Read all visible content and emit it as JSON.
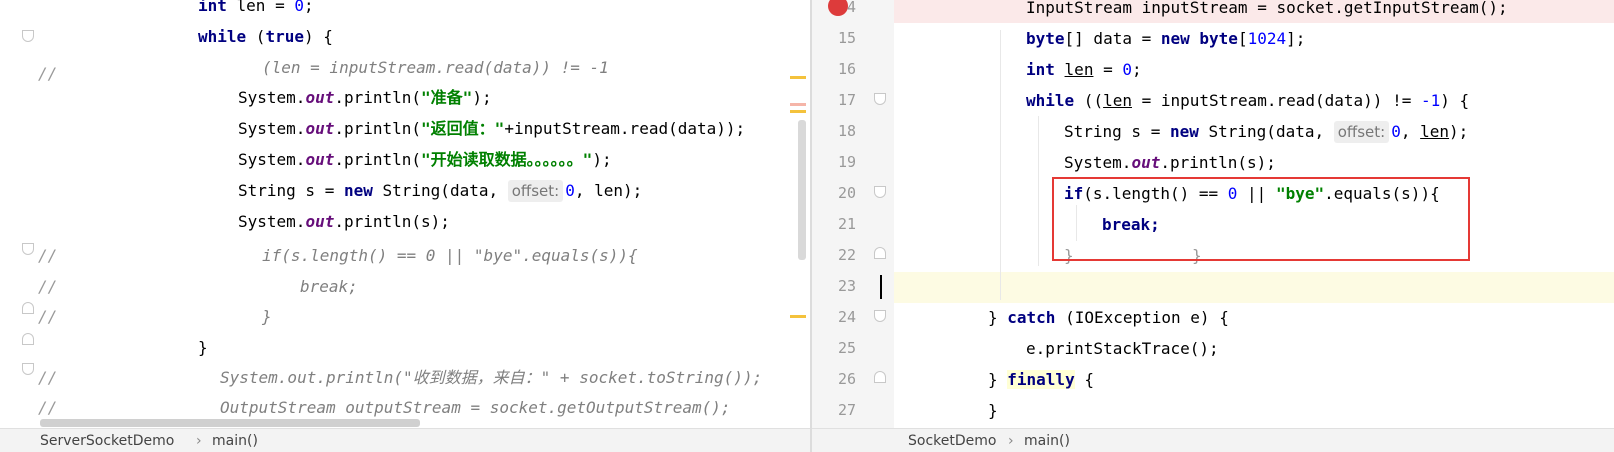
{
  "left_editor": {
    "breadcrumb": [
      "ServerSocketDemo",
      "main()"
    ],
    "comment_marker": "//",
    "lines": {
      "l1_a": "int",
      "l1_b": " len = ",
      "l1_c": "0",
      "l1_d": ";",
      "l2_a": "while",
      "l2_b": " (",
      "l2_c": "true",
      "l2_d": ") {",
      "l3": "(len = inputStream.read(data)) != -1",
      "l4_a": "System.",
      "l4_b": "out",
      "l4_c": ".println(",
      "l4_d": "\"准备\"",
      "l4_e": ");",
      "l5_a": "System.",
      "l5_b": "out",
      "l5_c": ".println(",
      "l5_d": "\"返回值：\"",
      "l5_e": "+inputStream.read(data));",
      "l6_a": "System.",
      "l6_b": "out",
      "l6_c": ".println(",
      "l6_d": "\"开始读取数据。。。。。。\"",
      "l6_e": ");",
      "l7_a": "String s = ",
      "l7_b": "new",
      "l7_c": " String(data, ",
      "l7_hint": "offset:",
      "l7_d": "0",
      "l7_e": ", len);",
      "l8_a": "System.",
      "l8_b": "out",
      "l8_c": ".println(s);",
      "l9": "if(s.length() == 0 || \"bye\".equals(s)){",
      "l10": "break;",
      "l11": "}",
      "l12": "}",
      "l13": "System.out.println(\"收到数据，来自：\" + socket.toString());",
      "l14": "OutputStream outputStream = socket.getOutputStream();"
    }
  },
  "right_editor": {
    "breadcrumb": [
      "SocketDemo",
      "main()"
    ],
    "line_numbers": [
      "14",
      "15",
      "16",
      "17",
      "18",
      "19",
      "20",
      "21",
      "22",
      "23",
      "24",
      "25",
      "26",
      "27"
    ],
    "lines": {
      "r14": "InputStream inputStream = socket.getInputStream();",
      "r15_a": "byte",
      "r15_b": "[] data = ",
      "r15_c": "new",
      "r15_d": " ",
      "r15_e": "byte",
      "r15_f": "[",
      "r15_g": "1024",
      "r15_h": "];",
      "r16_a": "int",
      "r16_b": " ",
      "r16_c": "len",
      "r16_d": " = ",
      "r16_e": "0",
      "r16_f": ";",
      "r17_a": "while",
      "r17_b": " ((",
      "r17_c": "len",
      "r17_d": " = inputStream.read(data)) != ",
      "r17_e": "-1",
      "r17_f": ") {",
      "r18_a": "String s = ",
      "r18_b": "new",
      "r18_c": " String(data, ",
      "r18_hint": "offset:",
      "r18_d": "0",
      "r18_e": ", ",
      "r18_f": "len",
      "r18_g": ");",
      "r19_a": "System.",
      "r19_b": "out",
      "r19_c": ".println(s);",
      "r20_a": "if",
      "r20_b": "(s.length() == ",
      "r20_c": "0",
      "r20_d": " || ",
      "r20_e": "\"bye\"",
      "r20_f": ".equals(s)){",
      "r21": "break;",
      "r22_a": "}",
      "r22_b": "}",
      "r24_a": "} ",
      "r24_b": "catch",
      "r24_c": " (IOException e) {",
      "r25": "e.printStackTrace();",
      "r26_a": "} ",
      "r26_b": "finally",
      "r26_c": " {",
      "r27": "}"
    }
  },
  "colors": {
    "keyword": "#000080",
    "string": "#008000",
    "number": "#0000ff",
    "field": "#660e7a",
    "comment": "#808080",
    "highlight_box": "#e53935",
    "breakpoint": "#dd3b3b"
  },
  "icons": [
    "breakpoint-icon",
    "fold-icon",
    "chevron-right-icon"
  ]
}
